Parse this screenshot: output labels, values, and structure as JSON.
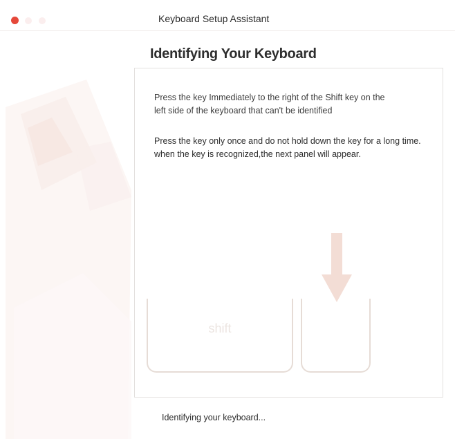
{
  "window": {
    "title": "Keyboard Setup Assistant",
    "close_button_color": "#e5483a"
  },
  "page": {
    "title": "Identifying Your Keyboard"
  },
  "instructions": {
    "line1": "Press the key Immediately to the right of the Shift key on the",
    "line2": "left side of the keyboard that can't be identified",
    "line3": "Press the key only once and do not hold down the key for a long time.",
    "line4": "when the key is recognized,the next panel will appear."
  },
  "keys": {
    "shift_label": "shift",
    "target_label": ""
  },
  "status": {
    "text": "Identifying your keyboard..."
  },
  "icons": {
    "close": "close-icon",
    "arrow": "down-arrow-icon",
    "sidebar_art": "keyboard-assistant-illustration"
  },
  "colors": {
    "accent": "#e5483a",
    "faint_arrow": "#f3ddd5",
    "key_outline": "#e6dcd6"
  }
}
